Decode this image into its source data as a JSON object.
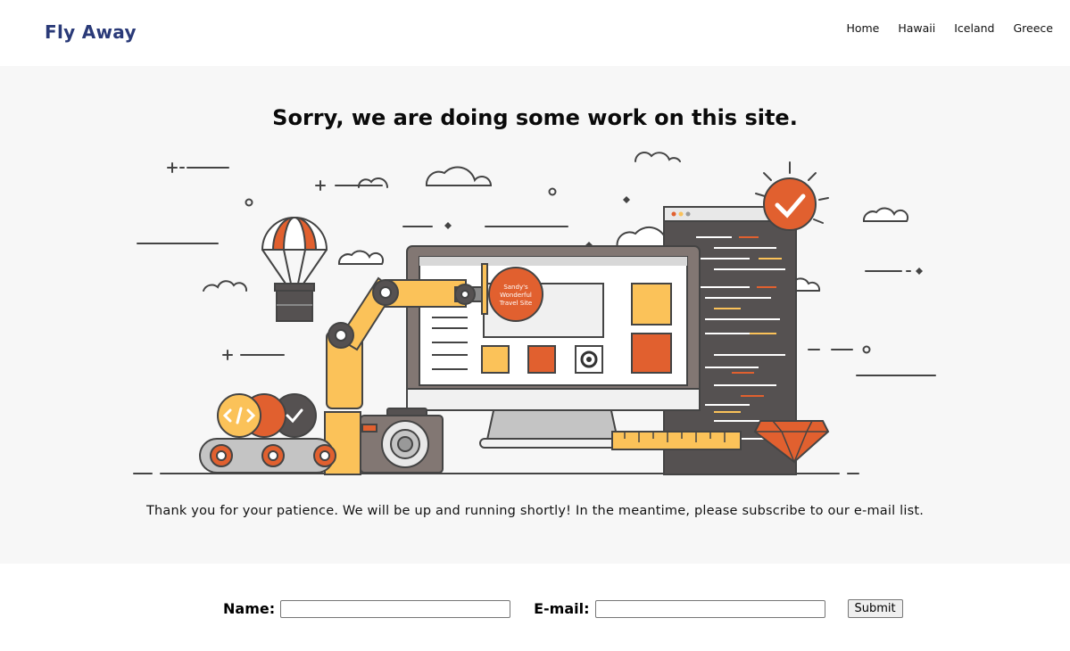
{
  "header": {
    "brand": "Fly Away",
    "nav": [
      {
        "label": "Home"
      },
      {
        "label": "Hawaii"
      },
      {
        "label": "Iceland"
      },
      {
        "label": "Greece"
      }
    ]
  },
  "hero": {
    "title": "Sorry, we are doing some work on this site.",
    "illustration_sign_text": [
      "Sandy's",
      "Wonderful",
      "Travel Site"
    ],
    "message": "Thank you for your patience. We will be up and running shortly! In the meantime, please subscribe to our e-mail list."
  },
  "form": {
    "name_label": "Name:",
    "name_value": "",
    "email_label": "E-mail:",
    "email_value": "",
    "submit_label": "Submit"
  },
  "colors": {
    "brand": "#2a3a78",
    "hero_bg": "#f7f7f7",
    "orange": "#e1602f",
    "yellow": "#fbc259",
    "dark": "#555151"
  }
}
